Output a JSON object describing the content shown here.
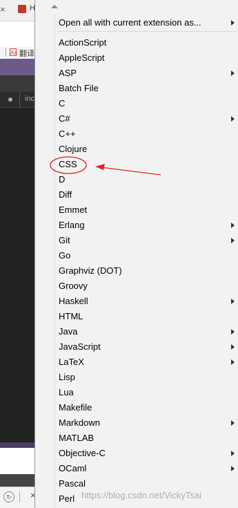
{
  "background_window": {
    "close_glyph": "×",
    "tab_text": "H",
    "bookmark_text": "翻译",
    "bookmark_icon": "Aa",
    "tab_label": "inc",
    "bottom_close": "×"
  },
  "menu": {
    "top_item": "Open all with current extension as...",
    "items": [
      {
        "label": "ActionScript",
        "submenu": false
      },
      {
        "label": "AppleScript",
        "submenu": false
      },
      {
        "label": "ASP",
        "submenu": true
      },
      {
        "label": "Batch File",
        "submenu": false
      },
      {
        "label": "C",
        "submenu": false
      },
      {
        "label": "C#",
        "submenu": true
      },
      {
        "label": "C++",
        "submenu": false
      },
      {
        "label": "Clojure",
        "submenu": false
      },
      {
        "label": "CSS",
        "submenu": false
      },
      {
        "label": "D",
        "submenu": false
      },
      {
        "label": "Diff",
        "submenu": false
      },
      {
        "label": "Emmet",
        "submenu": false
      },
      {
        "label": "Erlang",
        "submenu": true
      },
      {
        "label": "Git",
        "submenu": true
      },
      {
        "label": "Go",
        "submenu": false
      },
      {
        "label": "Graphviz (DOT)",
        "submenu": false
      },
      {
        "label": "Groovy",
        "submenu": false
      },
      {
        "label": "Haskell",
        "submenu": true
      },
      {
        "label": "HTML",
        "submenu": false
      },
      {
        "label": "Java",
        "submenu": true
      },
      {
        "label": "JavaScript",
        "submenu": true
      },
      {
        "label": "LaTeX",
        "submenu": true
      },
      {
        "label": "Lisp",
        "submenu": false
      },
      {
        "label": "Lua",
        "submenu": false
      },
      {
        "label": "Makefile",
        "submenu": false
      },
      {
        "label": "Markdown",
        "submenu": true
      },
      {
        "label": "MATLAB",
        "submenu": false
      },
      {
        "label": "Objective-C",
        "submenu": true
      },
      {
        "label": "OCaml",
        "submenu": true
      },
      {
        "label": "Pascal",
        "submenu": false
      },
      {
        "label": "Perl",
        "submenu": false
      }
    ]
  },
  "annotation": {
    "highlighted_item": "CSS",
    "color": "#e02020"
  },
  "watermark": "https://blog.csdn.net/VickyTsai",
  "colors": {
    "menu_background": "#f2f2f2",
    "annotation_red": "#e02020"
  }
}
